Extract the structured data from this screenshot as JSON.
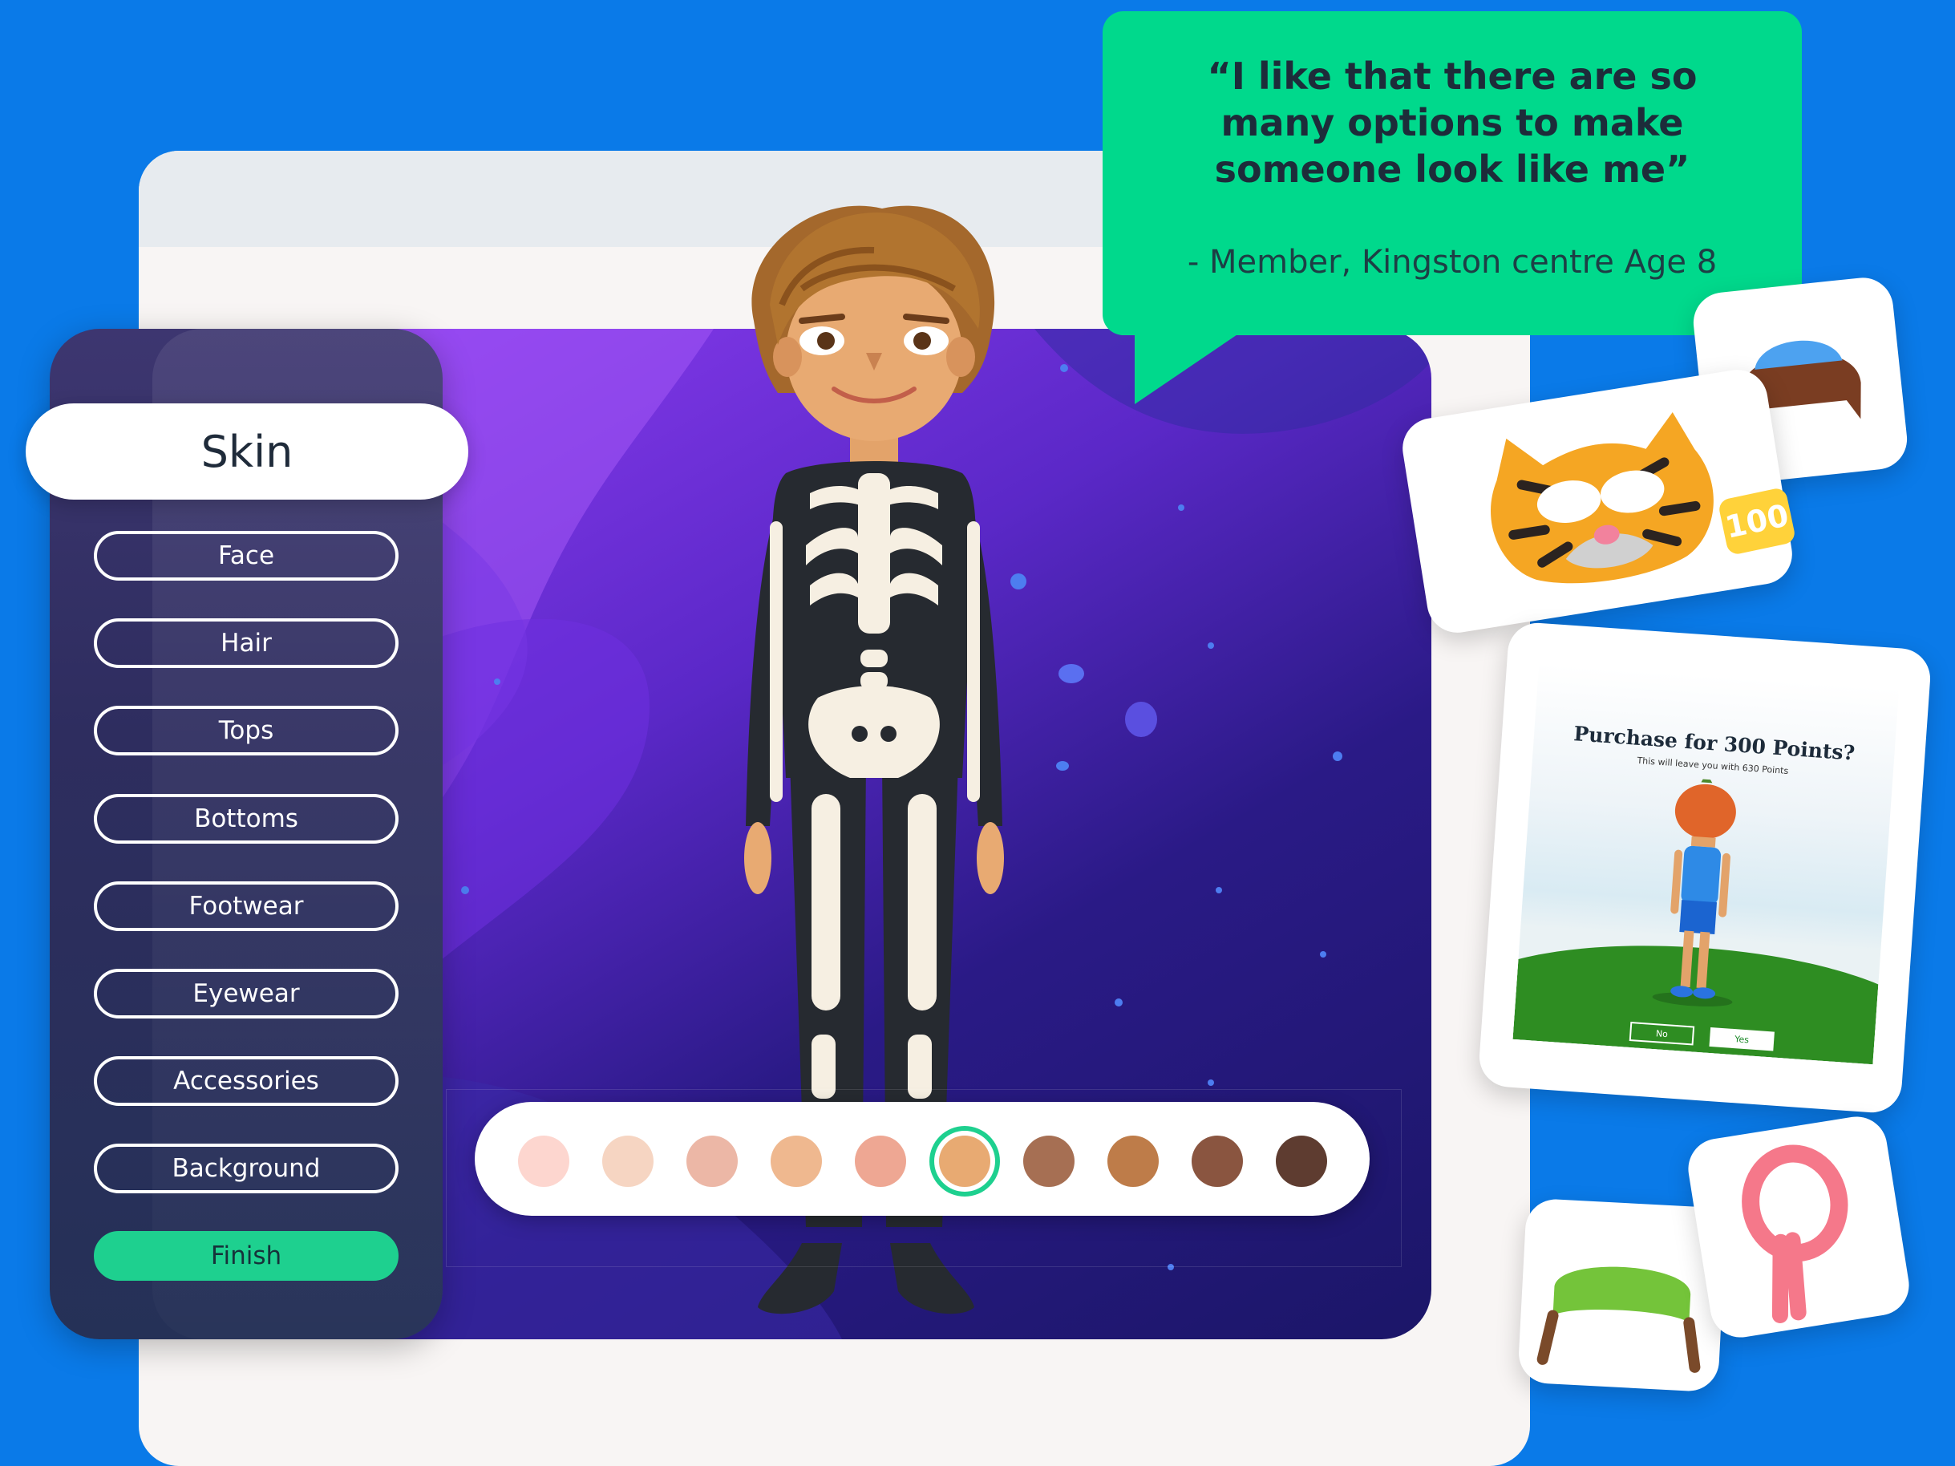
{
  "quote": {
    "text": "“I like that there are so many options to make someone look like me”",
    "attribution": "- Member, Kingston centre Age 8"
  },
  "menu": {
    "selected_title": "Skin",
    "items": [
      {
        "label": "Face"
      },
      {
        "label": "Hair"
      },
      {
        "label": "Tops"
      },
      {
        "label": "Bottoms"
      },
      {
        "label": "Footwear"
      },
      {
        "label": "Eyewear"
      },
      {
        "label": "Accessories"
      },
      {
        "label": "Background"
      }
    ],
    "finish_label": "Finish"
  },
  "skin_palette": {
    "swatches": [
      "#fdd6cf",
      "#f6d5c2",
      "#ecb7a6",
      "#efb88f",
      "#eea793",
      "#e8aa72",
      "#a66f53",
      "#be7c49",
      "#8a5540",
      "#5e3c30"
    ],
    "selected_index": 5,
    "accent": "#1ed08f"
  },
  "item_cards": {
    "price_badge": "100",
    "items": [
      "hat-hair-icon",
      "tiger-mask-icon",
      "green-headband-icon",
      "pink-scarf-icon"
    ]
  },
  "purchase_dialog": {
    "title": "Purchase for 300 Points?",
    "subtitle": "This will leave you with 630 Points",
    "no_label": "No",
    "yes_label": "Yes"
  },
  "colors": {
    "background": "#0a7ae8",
    "quote_green": "#00d98c",
    "finish_green": "#1ed08f",
    "badge_yellow": "#ffd23a"
  }
}
